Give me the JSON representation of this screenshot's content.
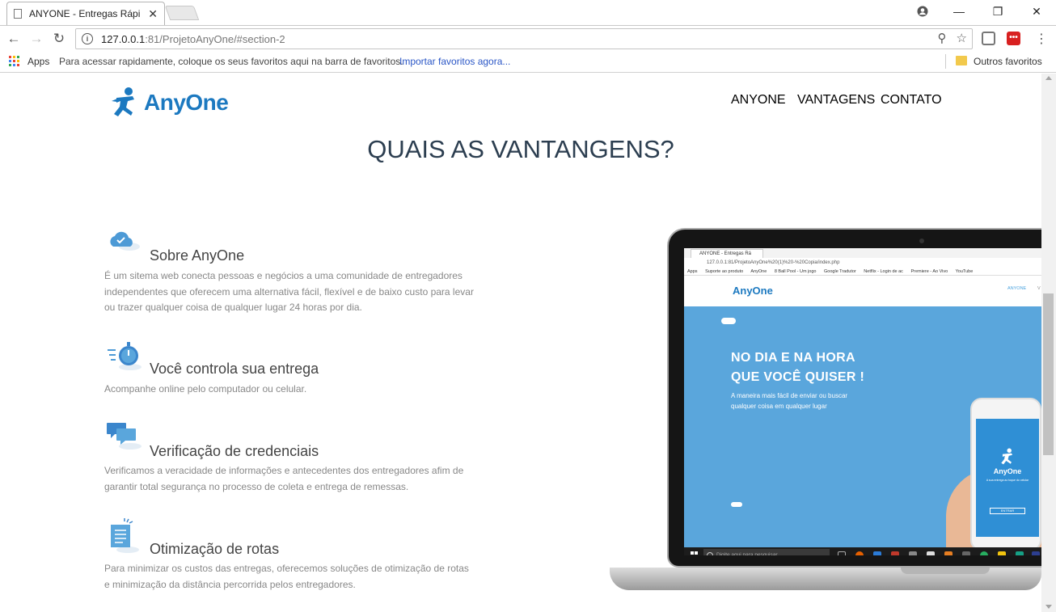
{
  "browser": {
    "tab_title": "ANYONE - Entregas Rápi",
    "tab_close": "✕",
    "url_host": "127.0.0.1",
    "url_path": ":81/ProjetoAnyOne/#section-2",
    "apps_label": "Apps",
    "bookmarks_hint": "Para acessar rapidamente, coloque os seus favoritos aqui na barra de favoritos.",
    "import_link": "Importar favoritos agora...",
    "other_bookmarks": "Outros favoritos"
  },
  "header": {
    "logo_text": "AnyOne",
    "nav": [
      "ANYONE",
      "VANTAGENS",
      "CONTATO"
    ]
  },
  "section": {
    "title": "QUAIS AS VANTANGENS?",
    "features": [
      {
        "icon": "cloud-check-icon",
        "title": "Sobre AnyOne",
        "desc": "É um sitema web conecta pessoas e negócios a uma comunidade de entregadores independentes que oferecem uma alternativa fácil, flexível e de baixo custo para levar ou trazer qualquer coisa de qualquer lugar 24 horas por dia."
      },
      {
        "icon": "stopwatch-icon",
        "title": "Você controla sua entrega",
        "desc": "Acompanhe online pelo computador ou celular."
      },
      {
        "icon": "chat-bubbles-icon",
        "title": "Verificação de credenciais",
        "desc": "Verificamos a veracidade de informações e antecedentes dos entregadores afim de garantir total segurança no processo de coleta e entrega de remessas."
      },
      {
        "icon": "document-list-icon",
        "title": "Otimização de rotas",
        "desc": "Para minimizar os custos das entregas, oferecemos soluções de otimização de rotas e minimização da distância percorrida pelos entregadores."
      }
    ]
  },
  "mockup": {
    "tab_title": "ANYONE - Entregas Rá",
    "url": "127.0.0.1:81/ProjetoAnyOne%20(1)%20-%20Copia/index.php",
    "bookmarks": [
      "Apps",
      "Suporte ao produto",
      "AnyOne",
      "8 Ball Pool - Um jogo",
      "Google Tradutor",
      "Netflix - Login de ac",
      "Premiere - Ao Vivo",
      "YouTube"
    ],
    "logo": "AnyOne",
    "nav_active": "ANYONE",
    "nav_next": "V",
    "hero_title_1": "NO DIA E NA HORA",
    "hero_title_2": "QUE VOCÊ QUISER !",
    "hero_sub": "A maneira mais fácil de enviar ou buscar qualquer coisa em qualquer lugar",
    "phone_logo": "AnyOne",
    "phone_tag": "A sua entrega ao toque do celular",
    "phone_button": "ENTRAR",
    "taskbar_search": "Digite aqui para pesquisar"
  },
  "colors": {
    "brand_blue": "#1c79c0",
    "hero_blue": "#5aa6dc",
    "heading": "#2c3e50",
    "muted_text": "#888888"
  }
}
